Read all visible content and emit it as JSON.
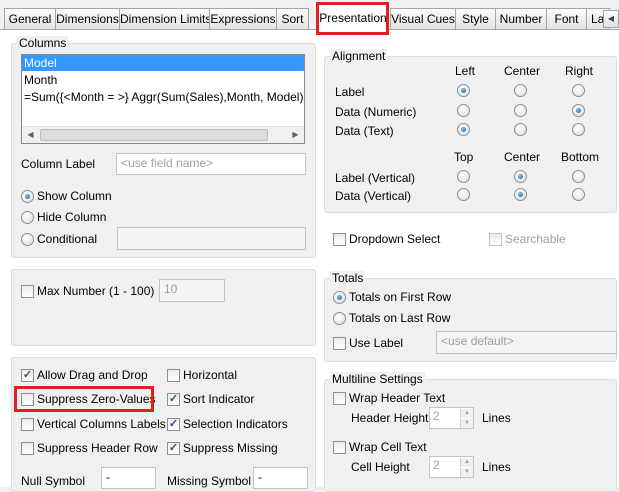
{
  "tabs": [
    "General",
    "Dimensions",
    "Dimension Limits",
    "Expressions",
    "Sort",
    "Presentation",
    "Visual Cues",
    "Style",
    "Number",
    "Font",
    "La"
  ],
  "columns": {
    "title": "Columns",
    "items": [
      "Model",
      "Month",
      "=Sum({<Month = >} Aggr(Sum(Sales),Month, Model)) //Tota"
    ],
    "column_label": "Column Label",
    "column_label_placeholder": "<use field name>",
    "show_column": "Show Column",
    "hide_column": "Hide Column",
    "conditional": "Conditional"
  },
  "alignment": {
    "title": "Alignment",
    "headers1": [
      "Left",
      "Center",
      "Right"
    ],
    "rows1": [
      "Label",
      "Data (Numeric)",
      "Data (Text)"
    ],
    "headers2": [
      "Top",
      "Center",
      "Bottom"
    ],
    "rows2": [
      "Label (Vertical)",
      "Data (Vertical)"
    ]
  },
  "dropdown_select": "Dropdown Select",
  "searchable": "Searchable",
  "max_number": {
    "label": "Max Number (1 - 100)",
    "value": "10"
  },
  "totals": {
    "title": "Totals",
    "first_row": "Totals on First Row",
    "last_row": "Totals on Last Row",
    "use_label": "Use Label",
    "label_placeholder": "<use default>"
  },
  "options": {
    "allow_drag": "Allow Drag and Drop",
    "horizontal": "Horizontal",
    "suppress_zero": "Suppress Zero-Values",
    "sort_indicator": "Sort Indicator",
    "vertical_labels": "Vertical Columns Labels",
    "selection_indicators": "Selection Indicators",
    "suppress_header": "Suppress Header Row",
    "suppress_missing": "Suppress Missing"
  },
  "null_symbol": {
    "label": "Null Symbol",
    "value": "-"
  },
  "missing_symbol": {
    "label": "Missing Symbol",
    "value": "-"
  },
  "multiline": {
    "title": "Multiline Settings",
    "wrap_header": "Wrap Header Text",
    "header_height": "Header Height",
    "header_height_value": "2",
    "lines1": "Lines",
    "wrap_cell": "Wrap Cell Text",
    "cell_height": "Cell Height",
    "cell_height_value": "2",
    "lines2": "Lines"
  },
  "colors": {
    "highlight": "#e02020",
    "selection": "#3399ff"
  }
}
